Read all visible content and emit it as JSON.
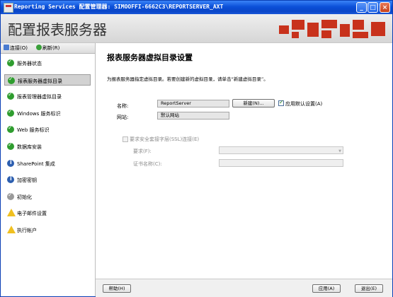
{
  "titlebar": {
    "title": "Reporting Services 配置管理器: SIMOOFFI-6662C3\\REPORTSERVER_AXT",
    "minimize": "_",
    "maximize": "□",
    "close": "×"
  },
  "header": {
    "title": "配置报表服务器"
  },
  "sidebar": {
    "toolbar": {
      "connect": "连接(O)",
      "refresh": "刷新(R)"
    },
    "items": [
      {
        "label": "服务器状态",
        "icon": "check-icon",
        "status": "ok"
      },
      {
        "label": "报表服务器虚拟目录",
        "icon": "check-icon",
        "status": "ok",
        "selected": true
      },
      {
        "label": "报表管理器虚拟目录",
        "icon": "check-icon",
        "status": "ok"
      },
      {
        "label": "Windows 服务标识",
        "icon": "check-icon",
        "status": "ok"
      },
      {
        "label": "Web 服务标识",
        "icon": "check-icon",
        "status": "ok"
      },
      {
        "label": "数据库安装",
        "icon": "check-icon",
        "status": "ok"
      },
      {
        "label": "SharePoint 集成",
        "icon": "info-icon",
        "status": "info"
      },
      {
        "label": "加密密钥",
        "icon": "info-icon",
        "status": "info"
      },
      {
        "label": "初始化",
        "icon": "check-icon",
        "status": "gray"
      },
      {
        "label": "电子邮件设置",
        "icon": "warning-icon",
        "status": "warn"
      },
      {
        "label": "执行帐户",
        "icon": "warning-icon",
        "status": "warn"
      }
    ]
  },
  "main": {
    "heading": "报表服务器虚拟目录设置",
    "description": "为报表服务器指定虚拟目录。若要创建新的虚拟目录，请单击“新建虚拟目录”。",
    "name_label": "名称:",
    "name_value": "ReportServer",
    "new_button": "新建(N)...",
    "apply_default_label": "应用默认设置(A)",
    "apply_default_checked": true,
    "website_label": "网站:",
    "website_value": "默认网站",
    "ssl_label": "要求安全套接字层(SSL)连接(E)",
    "ssl_checked": false,
    "require_label": "要求(F):",
    "require_value": "",
    "cert_label": "证书名称(C):",
    "cert_value": ""
  },
  "footer": {
    "help": "帮助(H)",
    "apply": "应用(A)",
    "exit": "退出(E)"
  },
  "colors": {
    "accent_red": "#c8321c",
    "titlebar_blue": "#0b4fd8",
    "ok_green": "#2f9d2f",
    "info_blue": "#2d5fb0",
    "warn_yellow": "#f0c020"
  }
}
